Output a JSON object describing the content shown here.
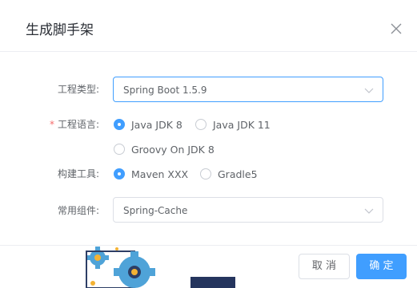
{
  "dialog": {
    "title": "生成脚手架",
    "close_icon": "close-icon"
  },
  "form": {
    "project_type": {
      "label": "工程类型:",
      "value": "Spring Boot 1.5.9",
      "icon": "chevron-down-icon"
    },
    "language": {
      "label": "工程语言:",
      "required": true,
      "options": [
        {
          "label": "Java JDK 8",
          "checked": true
        },
        {
          "label": "Java JDK 11",
          "checked": false
        },
        {
          "label": "Groovy On JDK 8",
          "checked": false
        }
      ]
    },
    "build_tool": {
      "label": "构建工具:",
      "options": [
        {
          "label": "Maven XXX",
          "checked": true
        },
        {
          "label": "Gradle5",
          "checked": false
        }
      ]
    },
    "components": {
      "label": "常用组件:",
      "value": "Spring-Cache",
      "icon": "chevron-down-icon"
    }
  },
  "footer": {
    "cancel_label": "取 消",
    "ok_label": "确 定"
  },
  "colors": {
    "primary": "#409eff",
    "required": "#f56c6c",
    "border": "#dcdfe6"
  }
}
